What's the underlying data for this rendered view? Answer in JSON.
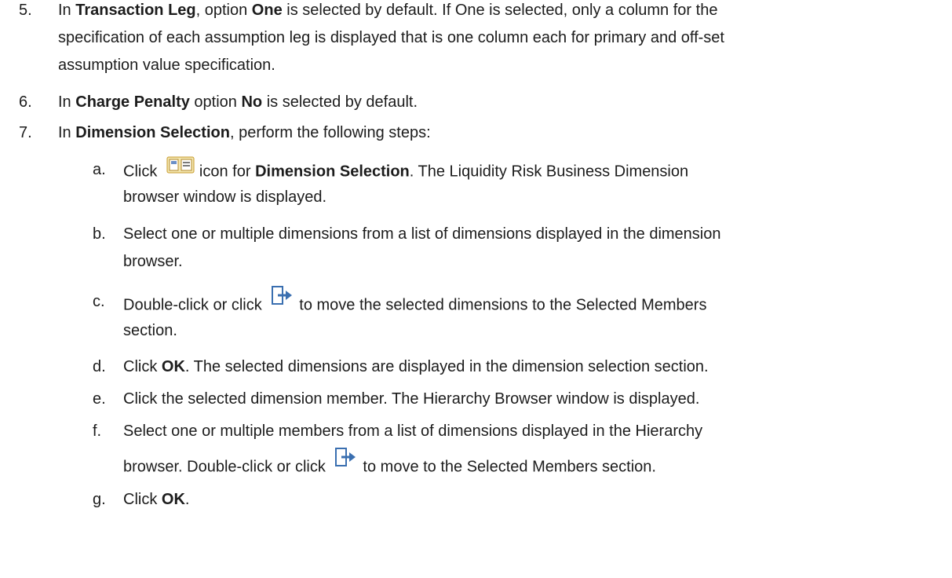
{
  "steps": [
    {
      "num": "5.",
      "t0": "In ",
      "t1": "Transaction Leg",
      "t2": ", option ",
      "t3": "One",
      "t4": " is selected by default. If One is selected, only a column for the",
      "l2": "specification of each assumption leg is displayed that is one column each for primary and off-set",
      "l3": "assumption value specification."
    },
    {
      "num": "6.",
      "t0": "In ",
      "t1": "Charge Penalty",
      "t2": " option ",
      "t3": "No",
      "t4": " is selected by default."
    },
    {
      "num": "7.",
      "t0": "In ",
      "t1": "Dimension Selection",
      "t2": ", perform the following steps:"
    }
  ],
  "sub": [
    {
      "num": "a.",
      "t0": "Click",
      "t1": "icon for ",
      "t2": "Dimension Selection",
      "t3": ". The Liquidity Risk Business Dimension",
      "l2": "browser window is displayed."
    },
    {
      "num": "b.",
      "l1": "Select one or multiple dimensions from a list of dimensions displayed in the dimension",
      "l2": "browser."
    },
    {
      "num": "c.",
      "t0": "Double-click or click",
      "t1": "to move the selected dimensions to the Selected Members",
      "l2": "section."
    },
    {
      "num": "d.",
      "t0": "Click ",
      "t1": "OK",
      "t2": ". The selected dimensions are displayed in the dimension selection section."
    },
    {
      "num": "e.",
      "l1": "Click the selected dimension member. The Hierarchy Browser window is displayed."
    },
    {
      "num": "f.",
      "l1": "Select one or multiple members from a list of dimensions displayed in the Hierarchy",
      "t0": "browser. Double-click or click",
      "t1": "to move to the Selected Members section."
    },
    {
      "num": "g.",
      "t0": "Click ",
      "t1": "OK",
      "t2": "."
    }
  ],
  "icons": [
    "dimension-browser-icon",
    "move-right-icon"
  ]
}
